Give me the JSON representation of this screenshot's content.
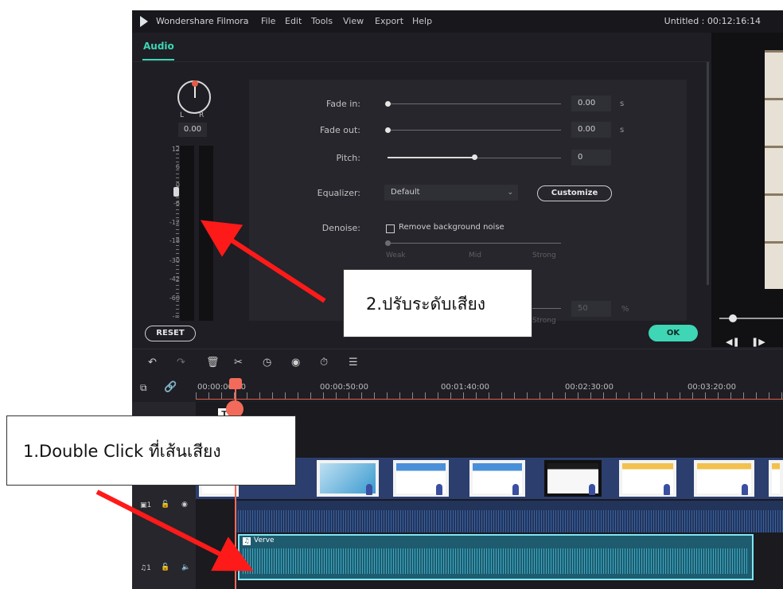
{
  "window": {
    "app_name": "Wondershare Filmora",
    "menu": [
      "File",
      "Edit",
      "Tools",
      "View",
      "Export",
      "Help"
    ],
    "project_title": "Untitled : 00:12:16:14"
  },
  "audio_panel": {
    "tab_label": "Audio",
    "pan": {
      "left_label": "L",
      "right_label": "R",
      "value": "0.00"
    },
    "meter_scale": [
      "12",
      "6",
      "0",
      "-6",
      "-12",
      "-18",
      "-30",
      "-42",
      "-60",
      "-∞"
    ],
    "fade_in": {
      "label": "Fade in:",
      "value": "0.00",
      "unit": "s"
    },
    "fade_out": {
      "label": "Fade out:",
      "value": "0.00",
      "unit": "s"
    },
    "pitch": {
      "label": "Pitch:",
      "value": "0",
      "level": 0.5
    },
    "equalizer": {
      "label": "Equalizer:",
      "selected": "Default",
      "customize_label": "Customize"
    },
    "denoise": {
      "label": "Denoise:",
      "checkbox_label": "Remove background noise",
      "checked": false,
      "weak": "Weak",
      "mid": "Mid",
      "strong": "Strong"
    },
    "extra": {
      "value": "50",
      "unit": "%",
      "strong": "Strong"
    },
    "reset_label": "RESET",
    "ok_label": "OK"
  },
  "timeline": {
    "ruler_labels": [
      "00:00:00:00",
      "00:00:50:00",
      "00:01:40:00",
      "00:02:30:00",
      "00:03:20:00"
    ],
    "video_track_label": "1",
    "audio_track_label": "1",
    "audio_clip_name": "Verve",
    "title_clip_label": "T"
  },
  "annotations": {
    "step1": "1.Double Click ที่เส้นเสียง",
    "step2": "2.ปรับระดับเสียง"
  },
  "colors": {
    "accent": "#3ed6b5",
    "playhead": "#f26b5a",
    "arrow": "#ff1a1a"
  }
}
